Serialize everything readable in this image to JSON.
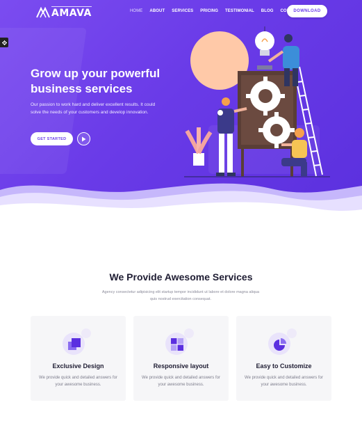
{
  "brand": {
    "name": "AMAVA",
    "accent": "#6b3de9"
  },
  "nav": {
    "items": [
      "HOME",
      "ABOUT",
      "SERVICES",
      "PRICING",
      "TESTIMONIAL",
      "BLOG",
      "CONTACT"
    ],
    "download_label": "DOWNLOAD"
  },
  "hero": {
    "title": "Grow up your powerful business services",
    "text": "Our passion to work hard and deliver excellent results. It could solve the needs of your customers and develop innovation.",
    "cta_label": "GET STARTED",
    "illustration_icon": "teamwork-gears-illustration"
  },
  "services": {
    "title": "We Provide Awesome Services",
    "subtitle": "Agency consectetur adipisicing elit startup tempor incididunt ut labore et dolore magna aliqua quis nostrud exercitation consequat.",
    "cards": [
      {
        "title": "Exclusive Design",
        "text": "We provide quick and detailed answers for your awesome business.",
        "icon": "layers-icon"
      },
      {
        "title": "Responsive layout",
        "text": "We provide quick and detailed answers for your awesome business.",
        "icon": "grid-icon"
      },
      {
        "title": "Easy to Customize",
        "text": "We provide quick and detailed answers for your awesome business.",
        "icon": "pie-chart-icon"
      }
    ]
  }
}
